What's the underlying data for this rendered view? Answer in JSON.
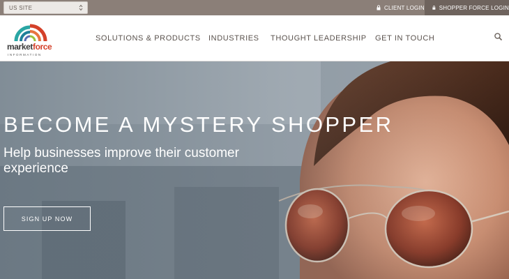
{
  "topbar": {
    "site_select": "US SITE",
    "client_login": "CLIENT LOGIN",
    "shopper_login": "SHOPPER FORCE LOGIN"
  },
  "logo": {
    "word_1": "market",
    "word_2": "force",
    "subtitle": "INFORMATION"
  },
  "nav": {
    "items": [
      {
        "label": "SOLUTIONS & PRODUCTS"
      },
      {
        "label": "INDUSTRIES"
      },
      {
        "label": "THOUGHT LEADERSHIP"
      },
      {
        "label": "GET IN TOUCH"
      }
    ],
    "search_icon": "search-icon"
  },
  "hero": {
    "title": "BECOME A MYSTERY SHOPPER",
    "subtitle": "Help businesses improve their customer experience",
    "cta_label": "SIGN UP NOW"
  },
  "colors": {
    "topbar": "#8b7f78",
    "topbar_active": "#6e635d",
    "logo_red": "#d4412a",
    "logo_teal": "#2aa6a4",
    "nav_text": "#5a524d"
  }
}
